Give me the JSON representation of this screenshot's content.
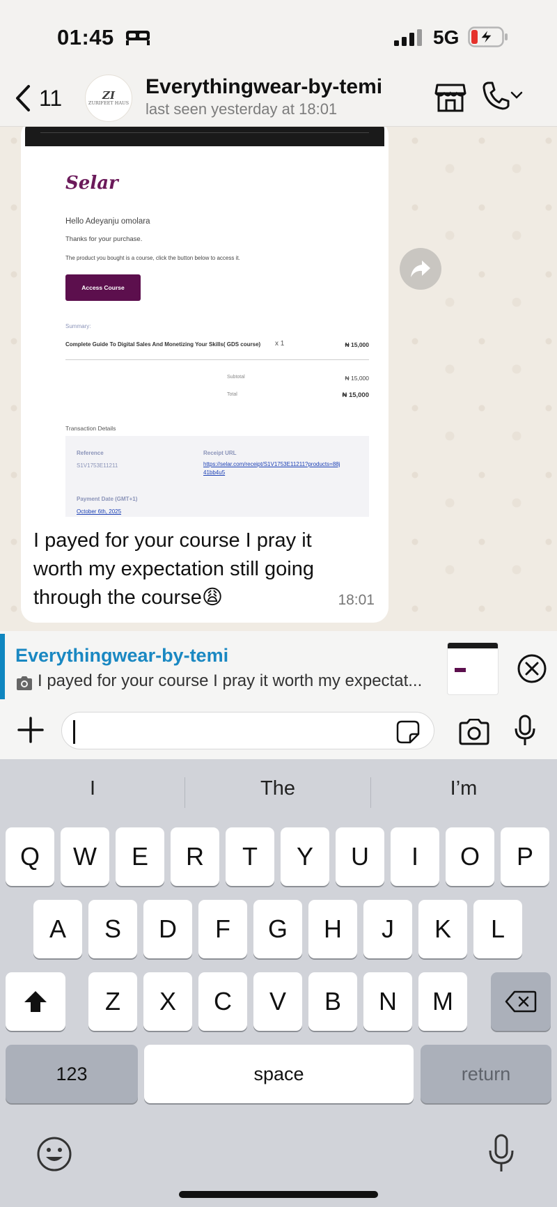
{
  "status_bar": {
    "time": "01:45",
    "network": "5G"
  },
  "header": {
    "back_count": "11",
    "avatar_monogram": "ZI",
    "avatar_text": "ZURIFEET HAUS",
    "contact_name": "Everythingwear-by-temi",
    "last_seen": "last seen yesterday at 18:01"
  },
  "message": {
    "receipt": {
      "logo": "Selar",
      "greeting": "Hello Adeyanju omolara",
      "thanks": "Thanks for your purchase.",
      "product_note": "The product you bought is a course, click the button below to access it.",
      "access_button": "Access Course",
      "summary_label": "Summary:",
      "item_name": "Complete Guide To Digital Sales And Monetizing Your Skills( GDS course)",
      "item_qty": "x 1",
      "item_price": "₦ 15,000",
      "subtotal_label": "Subtotal",
      "subtotal_value": "₦ 15,000",
      "total_label": "Total",
      "total_value": "₦ 15,000",
      "transaction_title": "Transaction Details",
      "reference_label": "Reference",
      "reference_value": "S1V1753E11211",
      "receipt_url_label": "Receipt URL",
      "receipt_url": "https://selar.com/receipt/S1V1753E11211?products=88j41bb4u5",
      "payment_date_label": "Payment Date (GMT+1)",
      "payment_date": "October 6th, 2025"
    },
    "caption": "I payed for your course I pray it worth my expectation still going through the course😩",
    "time": "18:01"
  },
  "reply_preview": {
    "name": "Everythingwear-by-temi",
    "text": "I payed for your course I pray it worth my expectat..."
  },
  "input": {
    "value": ""
  },
  "keyboard": {
    "suggestions": [
      "I",
      "The",
      "I’m"
    ],
    "row1": [
      "Q",
      "W",
      "E",
      "R",
      "T",
      "Y",
      "U",
      "I",
      "O",
      "P"
    ],
    "row2": [
      "A",
      "S",
      "D",
      "F",
      "G",
      "H",
      "J",
      "K",
      "L"
    ],
    "row3": [
      "Z",
      "X",
      "C",
      "V",
      "B",
      "N",
      "M"
    ],
    "numbers_key": "123",
    "space_key": "space",
    "return_key": "return"
  },
  "icons": {
    "status": [
      "bed-icon",
      "signal-icon",
      "battery-charging-icon"
    ],
    "header": [
      "chevron-left-icon",
      "store-icon",
      "phone-icon",
      "chevron-down-icon"
    ],
    "message": [
      "forward-icon"
    ],
    "reply": [
      "camera-small-icon",
      "close-circle-icon"
    ],
    "input": [
      "plus-icon",
      "sticker-icon",
      "camera-icon",
      "microphone-icon"
    ],
    "keyboard": [
      "shift-icon",
      "delete-icon",
      "emoji-icon",
      "dictation-icon"
    ]
  },
  "colors": {
    "accent_blue": "#1a88c2",
    "selar_purple": "#5c0f4d",
    "keyboard_bg": "#d1d3d9"
  }
}
